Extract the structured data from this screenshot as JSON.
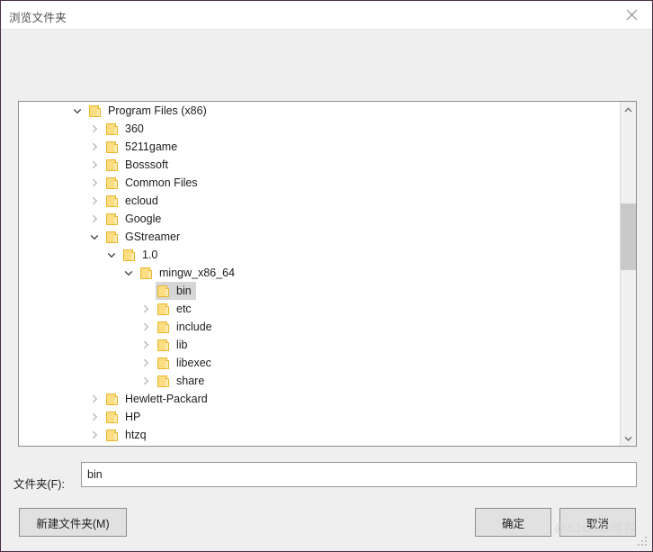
{
  "window": {
    "title": "浏览文件夹",
    "close_icon": "close-icon"
  },
  "tree": {
    "scrollbar": {
      "up_icon": "chevron-up-icon",
      "down_icon": "chevron-down-icon"
    },
    "nodes": [
      {
        "label": "Program Files (x86)",
        "depth": 0,
        "state": "expanded",
        "selected": false
      },
      {
        "label": "360",
        "depth": 1,
        "state": "collapsed",
        "selected": false
      },
      {
        "label": "5211game",
        "depth": 1,
        "state": "collapsed",
        "selected": false
      },
      {
        "label": "Bosssoft",
        "depth": 1,
        "state": "collapsed",
        "selected": false
      },
      {
        "label": "Common Files",
        "depth": 1,
        "state": "collapsed",
        "selected": false
      },
      {
        "label": "ecloud",
        "depth": 1,
        "state": "collapsed",
        "selected": false
      },
      {
        "label": "Google",
        "depth": 1,
        "state": "collapsed",
        "selected": false
      },
      {
        "label": "GStreamer",
        "depth": 1,
        "state": "expanded",
        "selected": false
      },
      {
        "label": "1.0",
        "depth": 2,
        "state": "expanded",
        "selected": false
      },
      {
        "label": "mingw_x86_64",
        "depth": 3,
        "state": "expanded",
        "selected": false
      },
      {
        "label": "bin",
        "depth": 4,
        "state": "leaf",
        "selected": true
      },
      {
        "label": "etc",
        "depth": 4,
        "state": "collapsed",
        "selected": false
      },
      {
        "label": "include",
        "depth": 4,
        "state": "collapsed",
        "selected": false
      },
      {
        "label": "lib",
        "depth": 4,
        "state": "collapsed",
        "selected": false
      },
      {
        "label": "libexec",
        "depth": 4,
        "state": "collapsed",
        "selected": false
      },
      {
        "label": "share",
        "depth": 4,
        "state": "collapsed",
        "selected": false
      },
      {
        "label": "Hewlett-Packard",
        "depth": 1,
        "state": "collapsed",
        "selected": false
      },
      {
        "label": "HP",
        "depth": 1,
        "state": "collapsed",
        "selected": false
      },
      {
        "label": "htzq",
        "depth": 1,
        "state": "collapsed",
        "selected": false
      }
    ]
  },
  "folder_field": {
    "label": "文件夹(F):",
    "value": "bin",
    "placeholder": ""
  },
  "buttons": {
    "new_folder": "新建文件夹(M)",
    "ok": "确定",
    "cancel": "取消"
  },
  "watermark": {
    "text": "@51CTO博客"
  },
  "colors": {
    "window_border": "#4a2d46",
    "titlebar_bg": "#ffffff",
    "dialog_bg": "#efefef",
    "tree_bg": "#ffffff",
    "selection_bg": "#d6d6d6",
    "folder_fill": "#fcdd81",
    "folder_stroke": "#e8b629",
    "button_bg": "#e1e1e1",
    "scrollbar_thumb": "#c9c9c9"
  }
}
